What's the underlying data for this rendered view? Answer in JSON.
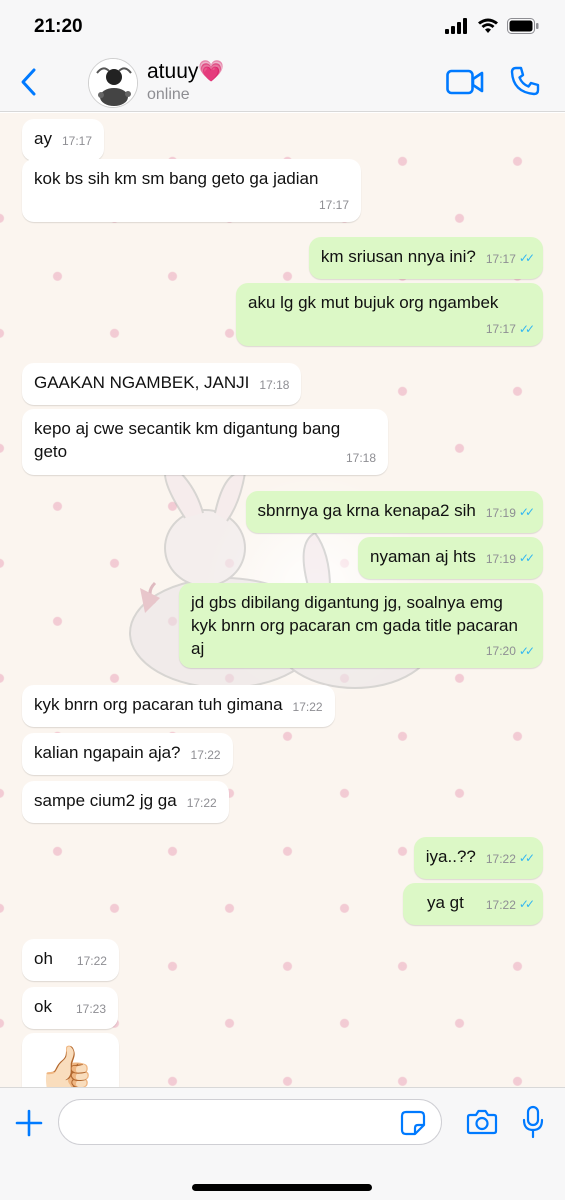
{
  "status_bar": {
    "time": "21:20"
  },
  "header": {
    "contact_name": "atuuy💗",
    "contact_status": "online"
  },
  "messages": [
    {
      "dir": "in",
      "text": "ay",
      "time": "17:17"
    },
    {
      "dir": "in",
      "text": "kok bs sih km sm bang geto ga jadian",
      "time": "17:17"
    },
    {
      "dir": "out",
      "text": "km sriusan nnya ini?",
      "time": "17:17"
    },
    {
      "dir": "out",
      "text": "aku lg gk mut bujuk org ngambek",
      "time": "17:17"
    },
    {
      "dir": "in",
      "text": "GAAKAN NGAMBEK, JANJI",
      "time": "17:18"
    },
    {
      "dir": "in",
      "text": "kepo aj cwe secantik km digantung bang geto",
      "time": "17:18"
    },
    {
      "dir": "out",
      "text": "sbnrnya ga krna kenapa2 sih",
      "time": "17:19"
    },
    {
      "dir": "out",
      "text": "nyaman aj hts",
      "time": "17:19"
    },
    {
      "dir": "out",
      "text": "jd gbs dibilang digantung jg, soalnya emg kyk bnrn org pacaran cm gada title pacaran aj",
      "time": "17:20"
    },
    {
      "dir": "in",
      "text": "kyk bnrn org pacaran tuh gimana",
      "time": "17:22"
    },
    {
      "dir": "in",
      "text": "kalian ngapain aja?",
      "time": "17:22"
    },
    {
      "dir": "in",
      "text": "sampe cium2 jg ga",
      "time": "17:22"
    },
    {
      "dir": "out",
      "text": "iya..??",
      "time": "17:22"
    },
    {
      "dir": "out",
      "text": "ya gt",
      "time": "17:22"
    },
    {
      "dir": "in",
      "text": "oh",
      "time": "17:22"
    },
    {
      "dir": "in",
      "text": "ok",
      "time": "17:23"
    },
    {
      "dir": "in",
      "text": "👍🏻",
      "time": ""
    }
  ],
  "input_bar": {
    "placeholder": ""
  },
  "colors": {
    "accent": "#007aff",
    "outgoing_bubble": "#dcf8c6",
    "incoming_bubble": "#ffffff",
    "read_ticks": "#34b7f1",
    "chat_background": "#fbf5ef"
  }
}
